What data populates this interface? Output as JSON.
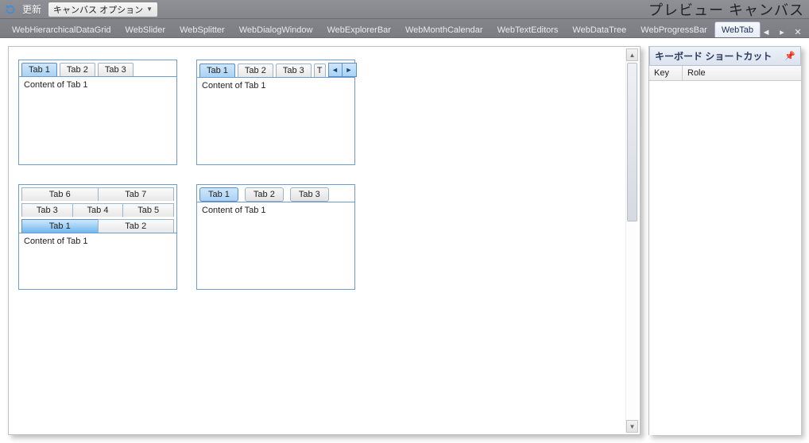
{
  "toolbar": {
    "refresh": "更新",
    "canvas_options": "キャンバス オプション",
    "title": "プレビュー キャンバス"
  },
  "tabs": [
    "WebHierarchicalDataGrid",
    "WebSlider",
    "WebSplitter",
    "WebDialogWindow",
    "WebExplorerBar",
    "WebMonthCalendar",
    "WebTextEditors",
    "WebDataTree",
    "WebProgressBar",
    "WebTab"
  ],
  "demos": [
    {
      "tabs": [
        "Tab 1",
        "Tab 2",
        "Tab 3"
      ],
      "selected": 0,
      "content": "Content of Tab 1"
    },
    {
      "tabs": [
        "Tab 1",
        "Tab 2",
        "Tab 3",
        "T"
      ],
      "selected": 0,
      "content": "Content of Tab 1"
    },
    {
      "rows": [
        [
          "Tab 6",
          "Tab 7"
        ],
        [
          "Tab 3",
          "Tab 4",
          "Tab 5"
        ],
        [
          "Tab 1",
          "Tab 2"
        ]
      ],
      "selected": "Tab 1",
      "content": "Content of Tab 1"
    },
    {
      "tabs": [
        "Tab 1",
        "Tab 2",
        "Tab 3"
      ],
      "selected": 0,
      "content": "Content of Tab 1"
    }
  ],
  "side": {
    "title": "キーボード ショートカット",
    "columns": [
      "Key",
      "Role"
    ]
  }
}
